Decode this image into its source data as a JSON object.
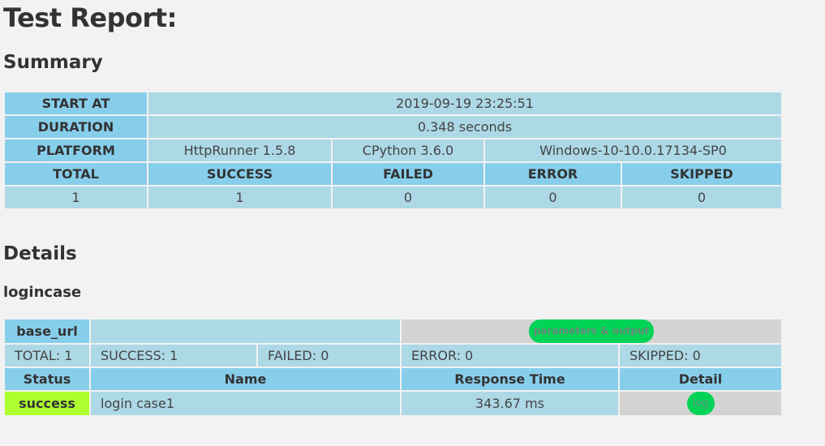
{
  "report": {
    "title": "Test Report:"
  },
  "summary": {
    "heading": "Summary",
    "start_at_label": "START AT",
    "start_at_value": "2019-09-19 23:25:51",
    "duration_label": "DURATION",
    "duration_value": "0.348 seconds",
    "platform_label": "PLATFORM",
    "platform_httprunner": "HttpRunner 1.5.8",
    "platform_python": "CPython 3.6.0",
    "platform_os": "Windows-10-10.0.17134-SP0",
    "columns": [
      "TOTAL",
      "SUCCESS",
      "FAILED",
      "ERROR",
      "SKIPPED"
    ],
    "values": [
      "1",
      "1",
      "0",
      "0",
      "0"
    ]
  },
  "details": {
    "heading": "Details",
    "case_name": "logincase",
    "base_url_label": "base_url",
    "base_url_value": "",
    "params_button": "parameters & output",
    "stats": {
      "total": "TOTAL: 1",
      "success": "SUCCESS: 1",
      "failed": "FAILED: 0",
      "error": "ERROR: 0",
      "skipped": "SKIPPED: 0"
    },
    "columns": [
      "Status",
      "Name",
      "Response Time",
      "Detail"
    ],
    "rows": [
      {
        "status": "success",
        "name": "login case1",
        "response_time": "343.67 ms",
        "detail_button": "log"
      }
    ]
  },
  "colors": {
    "page_bg": "#f2f2f2",
    "header_cell": "#87ceeb",
    "value_cell": "#add8e6",
    "grey_cell": "#d3d3d3",
    "success_cell": "#adff2f",
    "pill_button": "#00d457"
  }
}
